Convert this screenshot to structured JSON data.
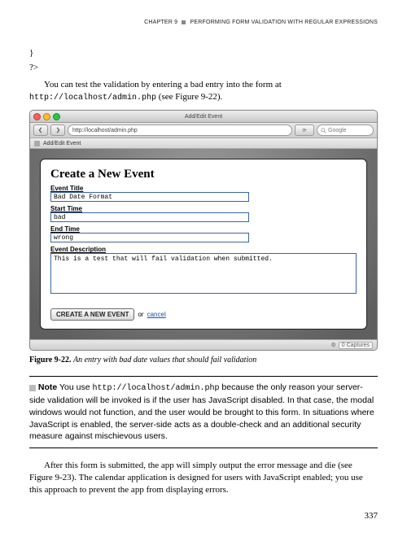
{
  "header": {
    "chapter": "CHAPTER 9",
    "title": "PERFORMING FORM VALIDATION WITH REGULAR EXPRESSIONS"
  },
  "code": {
    "brace": "}",
    "phpclose": "?>"
  },
  "intro": {
    "pre": "You can test the validation by entering a bad entry into the form at ",
    "url": "http://localhost/admin.php",
    "post": " (see Figure 9-22)."
  },
  "window": {
    "title": "Add/Edit Event",
    "back_tip": "Back",
    "fwd_tip": "Forward",
    "address": "http://localhost/admin.php",
    "search_placeholder": "Google",
    "bookmark": "Add/Edit Event",
    "zone": "0 Captures"
  },
  "form": {
    "title": "Create a New Event",
    "labels": {
      "event_title": "Event Title",
      "start_time": "Start Time",
      "end_time": "End Time",
      "description": "Event Description"
    },
    "values": {
      "event_title": "Bad Date Format",
      "start_time": "bad",
      "end_time": "wrong",
      "description": "This is a test that will fail validation when submitted."
    },
    "submit": "CREATE A NEW EVENT",
    "or": "or",
    "cancel": "cancel"
  },
  "figure": {
    "num": "Figure 9-22.",
    "caption": "An entry with bad date values that should fail validation"
  },
  "note": {
    "lead": "Note",
    "pre": " You use ",
    "url": "http://localhost/admin.php",
    "rest": " because the only reason your server-side validation will be invoked is if the user has JavaScript disabled. In that case, the modal windows would not function, and the user would be brought to this form. In situations where JavaScript is enabled, the server-side acts as a double-check and an additional security measure against mischievous users."
  },
  "after": "After this form is submitted, the app will simply output the error message and die (see Figure 9-23). The calendar application is designed for users with JavaScript enabled; you use this approach to prevent the app from displaying errors.",
  "pagenum": "337"
}
